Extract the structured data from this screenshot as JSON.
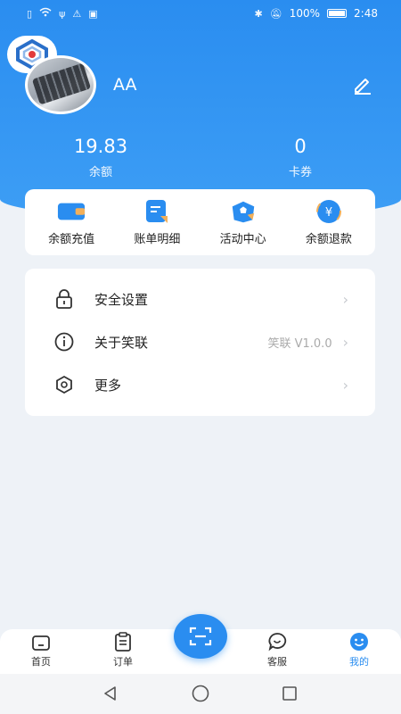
{
  "status_bar": {
    "battery": "100%",
    "time": "2:48"
  },
  "profile": {
    "name": "AA"
  },
  "stats": [
    {
      "value": "19.83",
      "label": "余额"
    },
    {
      "value": "0",
      "label": "卡券"
    }
  ],
  "quick_actions": [
    {
      "label": "余额充值",
      "icon": "wallet-icon"
    },
    {
      "label": "账单明细",
      "icon": "bill-icon"
    },
    {
      "label": "活动中心",
      "icon": "activity-icon"
    },
    {
      "label": "余额退款",
      "icon": "refund-icon"
    }
  ],
  "menu": [
    {
      "label": "安全设置",
      "value": "",
      "icon": "lock-icon"
    },
    {
      "label": "关于笑联",
      "value": "笑联 V1.0.0",
      "icon": "info-icon"
    },
    {
      "label": "更多",
      "value": "",
      "icon": "hexagon-icon"
    }
  ],
  "tabs": [
    {
      "label": "首页",
      "icon": "home-icon",
      "active": false
    },
    {
      "label": "订单",
      "icon": "clipboard-icon",
      "active": false
    },
    {
      "label": "客服",
      "icon": "chat-icon",
      "active": false
    },
    {
      "label": "我的",
      "icon": "smile-icon",
      "active": true
    }
  ],
  "colors": {
    "primary": "#2a8df0",
    "accent_orange": "#f3b05a"
  }
}
